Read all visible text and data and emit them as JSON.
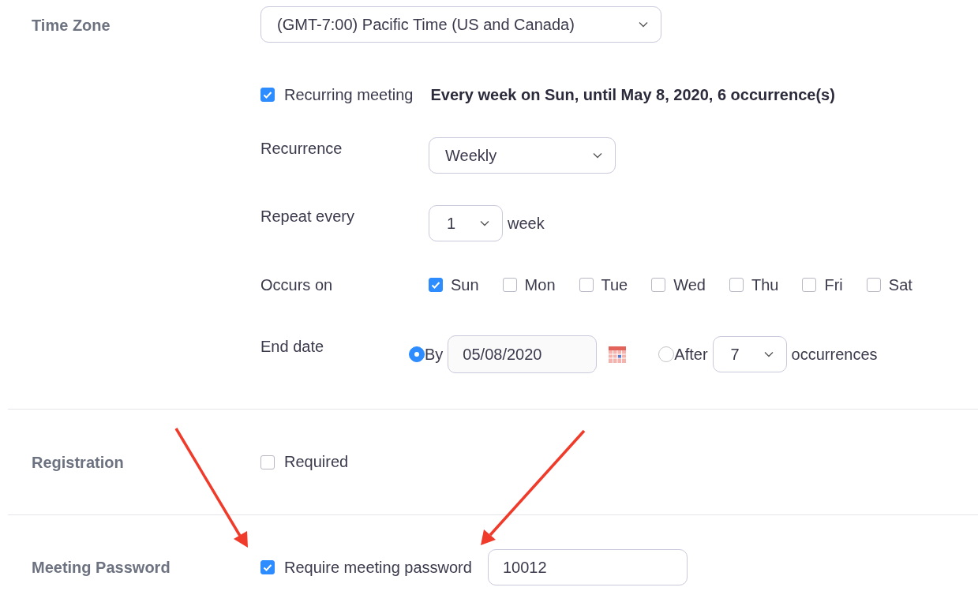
{
  "time_zone": {
    "label": "Time Zone",
    "value": "(GMT-7:00) Pacific Time (US and Canada)"
  },
  "recurring": {
    "label": "Recurring meeting",
    "checked": true,
    "summary": "Every week on Sun, until May 8, 2020, 6 occurrence(s)"
  },
  "recurrence": {
    "label": "Recurrence",
    "value": "Weekly"
  },
  "repeat_every": {
    "label": "Repeat every",
    "value": "1",
    "unit": "week"
  },
  "occurs_on": {
    "label": "Occurs on",
    "days": [
      {
        "label": "Sun",
        "checked": true
      },
      {
        "label": "Mon",
        "checked": false
      },
      {
        "label": "Tue",
        "checked": false
      },
      {
        "label": "Wed",
        "checked": false
      },
      {
        "label": "Thu",
        "checked": false
      },
      {
        "label": "Fri",
        "checked": false
      },
      {
        "label": "Sat",
        "checked": false
      }
    ]
  },
  "end_date": {
    "label": "End date",
    "options": [
      {
        "kind": "date",
        "label": "By",
        "selected": true,
        "value": "05/08/2020"
      },
      {
        "kind": "count",
        "label": "After",
        "selected": false,
        "value": "7",
        "unit": "occurrences"
      }
    ]
  },
  "registration": {
    "label": "Registration",
    "option": {
      "label": "Required",
      "checked": false
    }
  },
  "meeting_password": {
    "label": "Meeting Password",
    "option": {
      "label": "Require meeting password",
      "checked": true
    },
    "value": "10012"
  }
}
